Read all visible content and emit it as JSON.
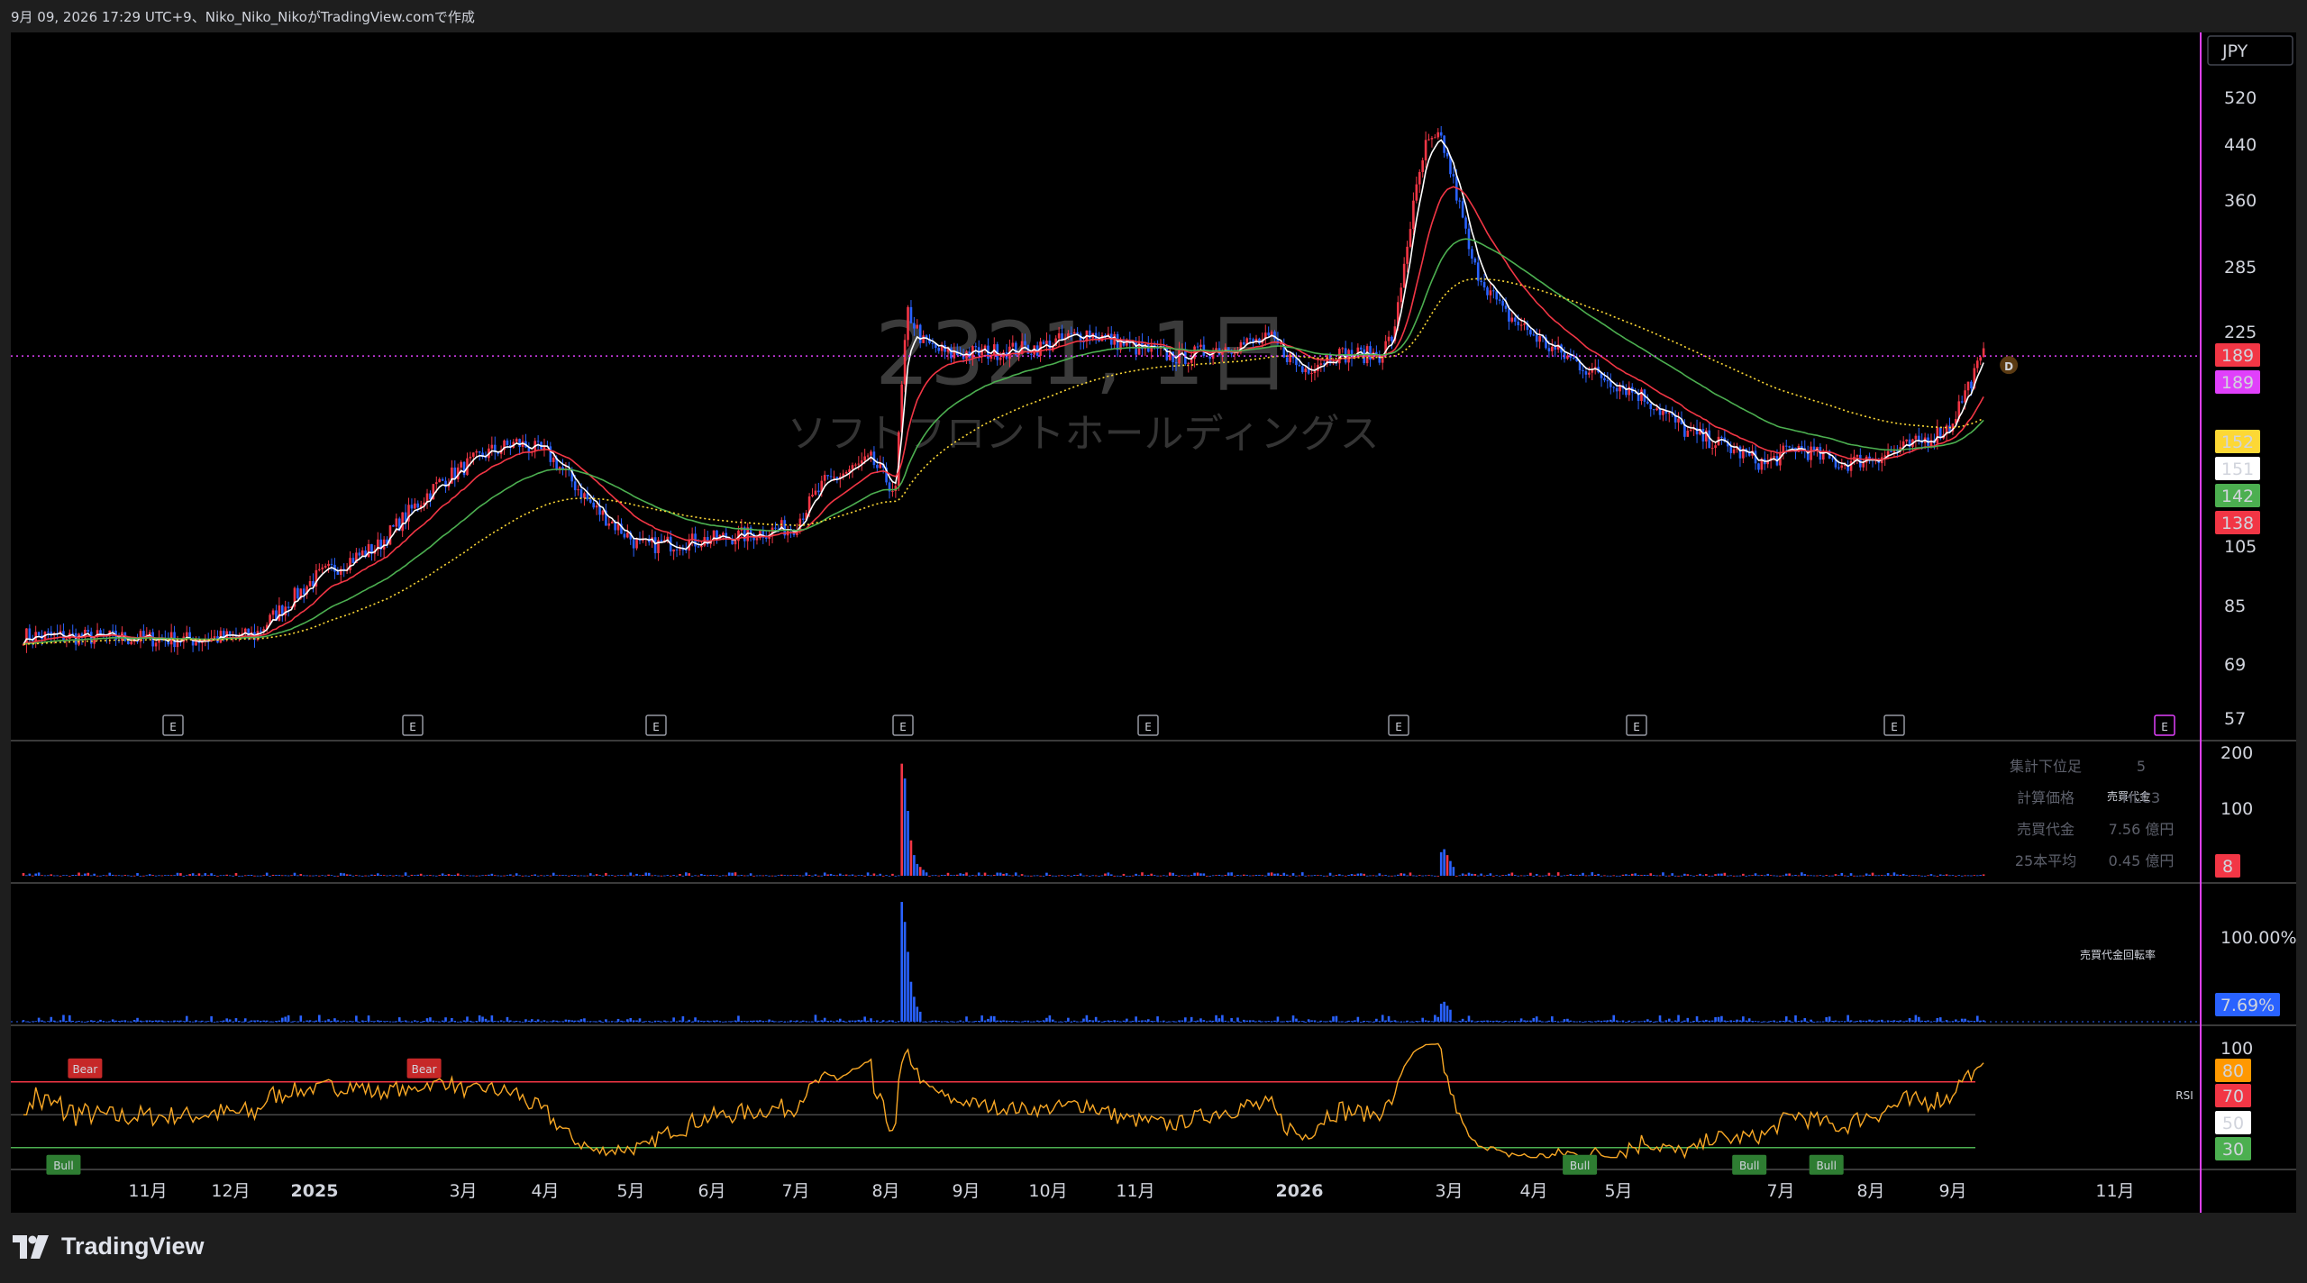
{
  "header": {
    "text": "9月 09, 2026 17:29 UTC+9、Niko_Niko_NikoがTradingView.comで作成"
  },
  "brand": {
    "name": "TradingView"
  },
  "watermark": {
    "symbol": "2321, 1日",
    "company": "ソフトフロントホールディングス"
  },
  "currency": "JPY",
  "colors": {
    "up": "#f23645",
    "down": "#2962ff",
    "ma_white": "#ffffff",
    "ma_red": "#f23645",
    "ma_green": "#4caf50",
    "ma_yellow": "#fdd835",
    "rsi": "#f9a825",
    "magenta": "#e040fb"
  },
  "chart_data": [
    {
      "type": "candlestick",
      "pane": "price",
      "scale": "log",
      "ylim": [
        55,
        560
      ],
      "price_ticks": [
        "520",
        "440",
        "360",
        "285",
        "225",
        "105",
        "85",
        "69",
        "57"
      ],
      "x_ticks": [
        "11月",
        "12月",
        "2025",
        "3月",
        "4月",
        "5月",
        "6月",
        "7月",
        "8月",
        "9月",
        "10月",
        "11月",
        "2026",
        "3月",
        "4月",
        "5月",
        "7月",
        "8月",
        "9月",
        "11月"
      ],
      "earnings_marker": "E",
      "dividend_marker": "D",
      "price_tags": [
        {
          "value": "189",
          "color": "#f23645",
          "text_color": "#ffffff"
        },
        {
          "value": "189",
          "color": "#e040fb",
          "text_color": "#ffffff"
        },
        {
          "value": "152",
          "color": "#fdd835",
          "text_color": "#000000"
        },
        {
          "value": "151",
          "color": "#ffffff",
          "text_color": "#000000"
        },
        {
          "value": "142",
          "color": "#4caf50",
          "text_color": "#000000"
        },
        {
          "value": "138",
          "color": "#f23645",
          "text_color": "#ffffff"
        }
      ],
      "close_anchors": [
        [
          0,
          72
        ],
        [
          55,
          71
        ],
        [
          75,
          72
        ],
        [
          95,
          88
        ],
        [
          115,
          98
        ],
        [
          135,
          122
        ],
        [
          150,
          135
        ],
        [
          160,
          140
        ],
        [
          170,
          135
        ],
        [
          185,
          112
        ],
        [
          200,
          98
        ],
        [
          220,
          100
        ],
        [
          235,
          102
        ],
        [
          250,
          105
        ],
        [
          260,
          122
        ],
        [
          275,
          132
        ],
        [
          283,
          118
        ],
        [
          287,
          220
        ],
        [
          292,
          198
        ],
        [
          300,
          190
        ],
        [
          315,
          192
        ],
        [
          330,
          195
        ],
        [
          345,
          205
        ],
        [
          360,
          195
        ],
        [
          375,
          188
        ],
        [
          390,
          195
        ],
        [
          405,
          200
        ],
        [
          415,
          180
        ],
        [
          425,
          190
        ],
        [
          440,
          190
        ],
        [
          445,
          205
        ],
        [
          455,
          390
        ],
        [
          460,
          400
        ],
        [
          470,
          260
        ],
        [
          480,
          220
        ],
        [
          495,
          195
        ],
        [
          510,
          178
        ],
        [
          525,
          165
        ],
        [
          540,
          145
        ],
        [
          550,
          140
        ],
        [
          565,
          130
        ],
        [
          575,
          138
        ],
        [
          590,
          130
        ],
        [
          605,
          135
        ],
        [
          615,
          140
        ],
        [
          625,
          148
        ],
        [
          636,
          189
        ]
      ]
    },
    {
      "type": "bar",
      "pane": "value_traded",
      "ylim": [
        0,
        220
      ],
      "ticks": [
        "200",
        "100"
      ],
      "series_name": "売買代金",
      "legend": [
        {
          "label": "集計下位足",
          "value": "5"
        },
        {
          "label": "計算価格",
          "value": "HLC3"
        },
        {
          "label": "売買代金",
          "value": "7.56 億円"
        },
        {
          "label": "25本平均",
          "value": "0.45 億円"
        }
      ],
      "last_value": "8",
      "spikes": [
        [
          285,
          190
        ],
        [
          286,
          165
        ],
        [
          287,
          110
        ],
        [
          288,
          60
        ],
        [
          289,
          35
        ],
        [
          290,
          20
        ],
        [
          291,
          15
        ],
        [
          292,
          10
        ],
        [
          460,
          40
        ],
        [
          461,
          45
        ],
        [
          462,
          35
        ],
        [
          463,
          25
        ],
        [
          464,
          15
        ]
      ]
    },
    {
      "type": "bar",
      "pane": "turnover",
      "ylim": [
        0,
        130
      ],
      "ticks": [
        "100.00%"
      ],
      "series_name": "売買代金回転率",
      "last_value": "7.69%",
      "spikes": [
        [
          285,
          120
        ],
        [
          286,
          100
        ],
        [
          287,
          70
        ],
        [
          288,
          40
        ],
        [
          289,
          25
        ],
        [
          290,
          15
        ],
        [
          291,
          10
        ],
        [
          460,
          18
        ],
        [
          461,
          20
        ],
        [
          462,
          16
        ],
        [
          463,
          12
        ]
      ]
    },
    {
      "type": "line",
      "pane": "rsi",
      "ylim": [
        20,
        100
      ],
      "ticks": [
        "100"
      ],
      "series_name": "RSI",
      "levels": [
        {
          "value": "80",
          "color": "#ff9800",
          "text_color": "#000000"
        },
        {
          "value": "70",
          "color": "#f23645",
          "text_color": "#ffffff"
        },
        {
          "value": "50",
          "color": "#ffffff",
          "text_color": "#000000"
        },
        {
          "value": "30",
          "color": "#4caf50",
          "text_color": "#000000"
        }
      ],
      "signals": [
        {
          "bar": 20,
          "label": "Bear",
          "kind": "bear"
        },
        {
          "bar": 13,
          "label": "Bull",
          "kind": "bull"
        },
        {
          "bar": 130,
          "label": "Bear",
          "kind": "bear"
        },
        {
          "bar": 505,
          "label": "Bull",
          "kind": "bull"
        },
        {
          "bar": 560,
          "label": "Bull",
          "kind": "bull"
        },
        {
          "bar": 585,
          "label": "Bull",
          "kind": "bull"
        }
      ]
    }
  ]
}
